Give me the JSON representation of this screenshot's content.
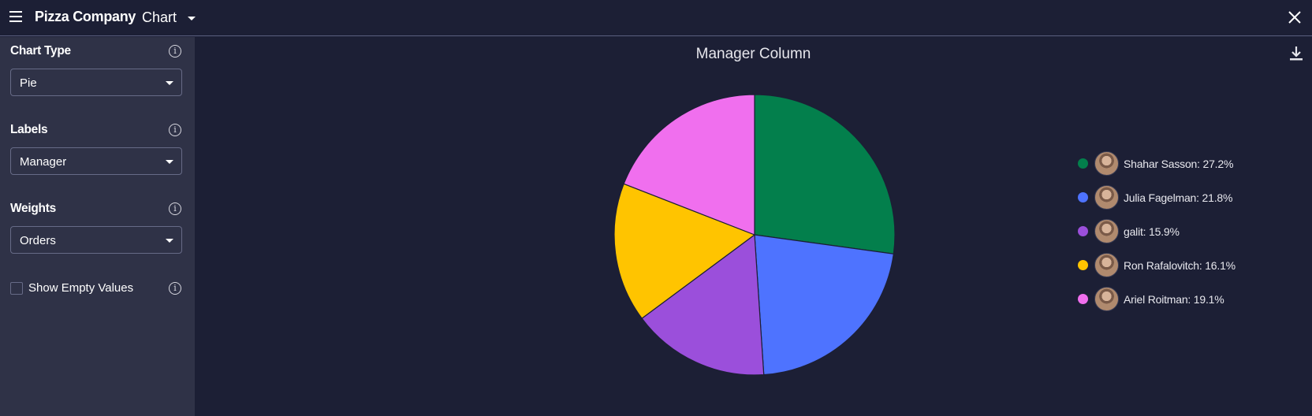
{
  "header": {
    "app_title": "Pizza Company",
    "view_title": "Chart"
  },
  "sidebar": {
    "chart_type": {
      "label": "Chart Type",
      "value": "Pie"
    },
    "labels": {
      "label": "Labels",
      "value": "Manager"
    },
    "weights": {
      "label": "Weights",
      "value": "Orders"
    },
    "show_empty": {
      "label": "Show Empty Values",
      "checked": false
    }
  },
  "chart_data": {
    "type": "pie",
    "title": "Manager Column",
    "start_angle": "12 o'clock, clockwise",
    "legend_position": "right",
    "slices": [
      {
        "label": "Shahar Sasson",
        "value": 27.2,
        "color": "#037f4c"
      },
      {
        "label": "Julia Fagelman",
        "value": 21.8,
        "color": "#4e73ff"
      },
      {
        "label": "galit",
        "value": 15.9,
        "color": "#9b4fdb"
      },
      {
        "label": "Ron Rafalovitch",
        "value": 16.1,
        "color": "#ffc400"
      },
      {
        "label": "Ariel Roitman",
        "value": 19.1,
        "color": "#f06fee"
      }
    ],
    "legend": [
      "Shahar Sasson: 27.2%",
      "Julia Fagelman: 21.8%",
      "galit: 15.9%",
      "Ron Rafalovitch: 16.1%",
      "Ariel Roitman: 19.1%"
    ]
  }
}
